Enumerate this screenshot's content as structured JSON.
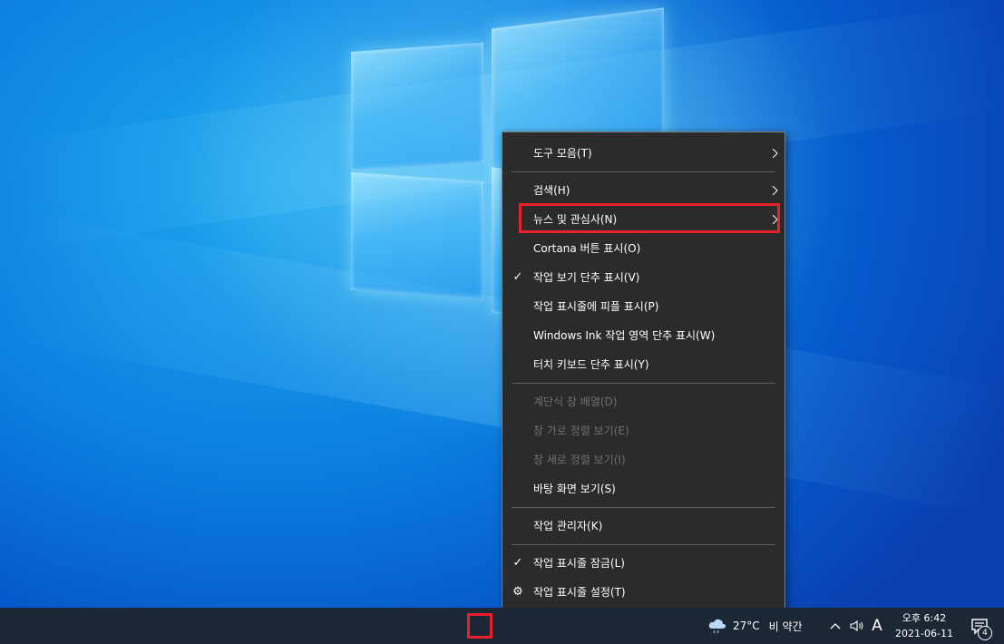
{
  "context_menu": {
    "items": [
      {
        "label": "도구 모음(T)",
        "submenu": true
      },
      {
        "label": "검색(H)",
        "submenu": true
      },
      {
        "label": "뉴스 및 관심사(N)",
        "submenu": true
      },
      {
        "label": "Cortana 버튼 표시(O)"
      },
      {
        "label": "작업 보기 단추 표시(V)",
        "checked": true
      },
      {
        "label": "작업 표시줄에 피플 표시(P)"
      },
      {
        "label": "Windows Ink 작업 영역 단추 표시(W)"
      },
      {
        "label": "터치 키보드 단추 표시(Y)"
      },
      {
        "label": "계단식 창 배열(D)",
        "disabled": true
      },
      {
        "label": "창 가로 정렬 보기(E)",
        "disabled": true
      },
      {
        "label": "창 세로 정렬 보기(I)",
        "disabled": true
      },
      {
        "label": "바탕 화면 보기(S)"
      },
      {
        "label": "작업 관리자(K)"
      },
      {
        "label": "작업 표시줄 잠금(L)",
        "checked": true
      },
      {
        "label": "작업 표시줄 설정(T)",
        "icon": "gear-icon"
      }
    ]
  },
  "taskbar": {
    "weather": {
      "temp": "27°C",
      "condition": "비 약간",
      "icon": "cloud-rain-icon"
    },
    "ime": "A",
    "clock": {
      "time": "오후 6:42",
      "date": "2021-06-11"
    },
    "notifications_count": "4"
  },
  "colors": {
    "menu_bg": "#2b2b2b",
    "highlight": "#e8202a",
    "taskbar_bg": "#1c2735"
  }
}
